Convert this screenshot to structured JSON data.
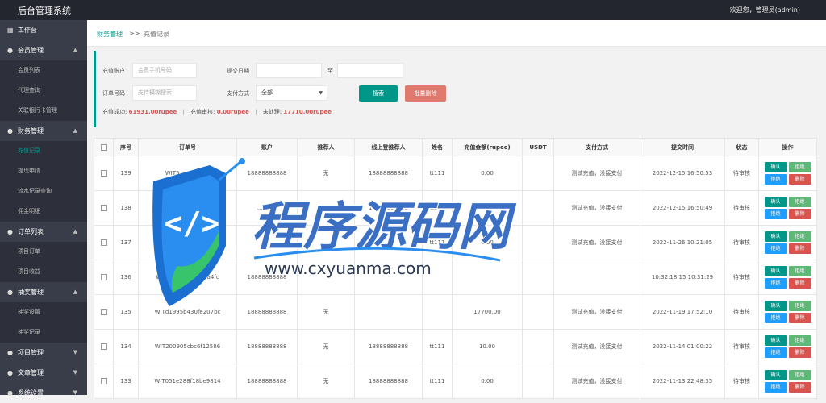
{
  "header": {
    "brand": "后台管理系统",
    "user": "欢迎您，管理员(admin)"
  },
  "sidebar": {
    "dashboard": "工作台",
    "groups": [
      {
        "label": "会员管理",
        "expanded": true,
        "items": [
          "会员列表",
          "代理查询",
          "关联银行卡管理"
        ]
      },
      {
        "label": "财务管理",
        "expanded": true,
        "items": [
          "充值记录",
          "提现申请",
          "流水记录查询",
          "佣金明细"
        ]
      },
      {
        "label": "订单列表",
        "expanded": true,
        "items": [
          "项目订单",
          "项目收益"
        ]
      },
      {
        "label": "抽奖管理",
        "expanded": true,
        "items": [
          "抽奖设置",
          "抽奖记录"
        ]
      },
      {
        "label": "项目管理",
        "expanded": false,
        "items": []
      },
      {
        "label": "文章管理",
        "expanded": false,
        "items": []
      },
      {
        "label": "系统设置",
        "expanded": false,
        "items": []
      }
    ],
    "active_item": "充值记录"
  },
  "breadcrumb": {
    "parent": "财务管理",
    "separator": ">>",
    "current": "充值记录"
  },
  "search": {
    "account_label": "充值账户",
    "account_placeholder": "会员手机号码",
    "date_label": "提交日期",
    "date_to": "至",
    "order_label": "订单号码",
    "order_placeholder": "支持模糊搜索",
    "pay_label": "支付方式",
    "pay_value": "全部",
    "search_button": "搜索",
    "batch_delete_button": "批量删除"
  },
  "stats": {
    "success_label": "充值成功:",
    "success_value": "61931.00rupee",
    "pending_label": "充值审核:",
    "pending_value": "0.00rupee",
    "failed_label": "未处理:",
    "failed_value": "17710.00rupee"
  },
  "table": {
    "headers": [
      "",
      "序号",
      "订单号",
      "账户",
      "推荐人",
      "线上登推荐人",
      "姓名",
      "充值金额(rupee)",
      "USDT",
      "支付方式",
      "提交时间",
      "状态",
      "操作"
    ],
    "rows": [
      {
        "id": "139",
        "order": "WIT5... ...57786",
        "account": "18888888888",
        "ref": "无",
        "online_ref": "18888888888",
        "name": "tt111",
        "amount": "0.00",
        "usdt": "",
        "method": "测试充值，没接支付",
        "time": "2022-12-15 16:50:53",
        "status": "待审核"
      },
      {
        "id": "138",
        "order": "",
        "account": "...8888",
        "ref": "无",
        "online_ref": "18888888888",
        "name": "tt111",
        "amount": "0.00",
        "usdt": "",
        "method": "测试充值，没接支付",
        "time": "2022-12-15 16:50:49",
        "status": "待审核"
      },
      {
        "id": "137",
        "order": "W... ...d7",
        "account": "",
        "ref": "",
        "online_ref": "",
        "name": "tt111",
        "amount": "0.00",
        "usdt": "",
        "method": "测试充值，没接支付",
        "time": "2022-11-26 10:21:05",
        "status": "待审核"
      },
      {
        "id": "136",
        "order": "WITaf247bb8b1dda4fc",
        "account": "18888888888",
        "ref": "",
        "online_ref": "",
        "name": "",
        "amount": "",
        "usdt": "",
        "method": "",
        "time": "10:32:18 15 10:31:29",
        "status": "待审核"
      },
      {
        "id": "135",
        "order": "WITd1995b430fe207bc",
        "account": "18888888888",
        "ref": "无",
        "online_ref": "",
        "name": "",
        "amount": "17700.00",
        "usdt": "",
        "method": "测试充值，没接支付",
        "time": "2022-11-19 17:52:10",
        "status": "待审核"
      },
      {
        "id": "134",
        "order": "WIT200905cbc6f12586",
        "account": "18888888888",
        "ref": "无",
        "online_ref": "18888888888",
        "name": "tt111",
        "amount": "10.00",
        "usdt": "",
        "method": "测试充值，没接支付",
        "time": "2022-11-14 01:00:22",
        "status": "待审核"
      },
      {
        "id": "133",
        "order": "WIT051e288f18be9814",
        "account": "18888888888",
        "ref": "无",
        "online_ref": "18888888888",
        "name": "tt111",
        "amount": "0.00",
        "usdt": "",
        "method": "测试充值，没接支付",
        "time": "2022-11-13 22:48:35",
        "status": "待审核"
      }
    ],
    "ops": {
      "confirm": "确认",
      "reject": "拒绝",
      "reject2": "拒绝",
      "delete": "删除"
    }
  },
  "watermark": {
    "title": "程序源码网",
    "url": "www.cxyuanma.com",
    "code_glyph": "</>"
  },
  "colors": {
    "accent": "#009688",
    "red": "#d9534f",
    "blue": "#1e9fff",
    "green": "#5fb878",
    "sidebar": "#393d49",
    "topbar": "#23262e"
  }
}
